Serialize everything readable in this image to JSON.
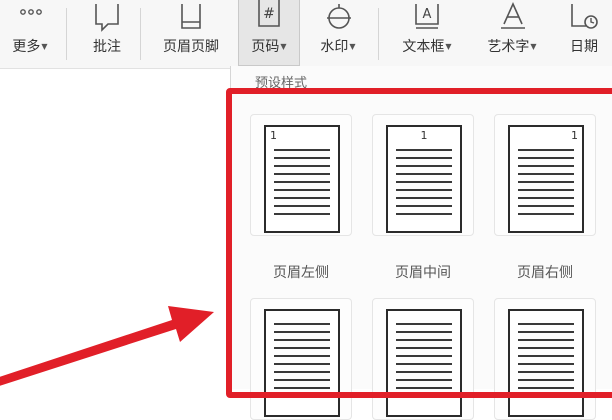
{
  "ribbon": {
    "more_label": "更多",
    "comment_label": "批注",
    "header_footer_label": "页眉页脚",
    "page_number_label": "页码",
    "watermark_label": "水印",
    "textbox_label": "文本框",
    "wordart_label": "艺术字",
    "date_label": "日期"
  },
  "dropdown": {
    "title": "预设样式",
    "presets": [
      {
        "label": "页眉左侧",
        "page_number": "1",
        "align": "left"
      },
      {
        "label": "页眉中间",
        "page_number": "1",
        "align": "center"
      },
      {
        "label": "页眉右侧",
        "page_number": "1",
        "align": "right"
      }
    ]
  },
  "colors": {
    "highlight_red": "#e11f28",
    "ribbon_bg": "#f7f7f7"
  }
}
